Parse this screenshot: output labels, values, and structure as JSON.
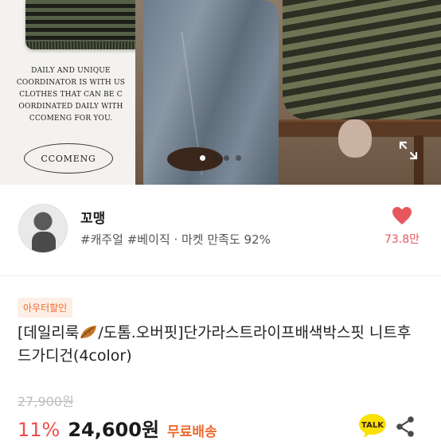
{
  "hero": {
    "slogan": "DAILY AND UNIQUE COORDINATOR IS WITH US CLOTHES THAT CAN BE C OORDINATED DAILY WITH CCOMENG FOR YOU.",
    "brand_logo": "CCOMENG",
    "carousel": {
      "total": 4,
      "active_index": 0
    }
  },
  "seller": {
    "name": "꼬맹",
    "tags": "#캐주얼 #베이직 · 마켓 만족도 92%",
    "likes": "73.8만"
  },
  "product": {
    "badge": "아우터할인",
    "title_part1": "[데일리룩",
    "title_part2": "/도톰.오버핏]단가라스트라이프배색박스핏 니트후드가디건(4color)",
    "original_price": "27,900원",
    "discount": "11%",
    "price": "24,600원",
    "shipping": "무료배송"
  },
  "colors": {
    "accent_red": "#f04b4b",
    "heart": "#e8575d",
    "orange": "#ee6b2f",
    "badge_bg": "#fdeee6",
    "talk_yellow": "#fae100"
  },
  "icons": {
    "expand": "expand-icon",
    "heart": "heart-icon",
    "leaf": "leaf-emoji-icon",
    "talk": "kakao-talk-icon",
    "share": "share-icon"
  }
}
